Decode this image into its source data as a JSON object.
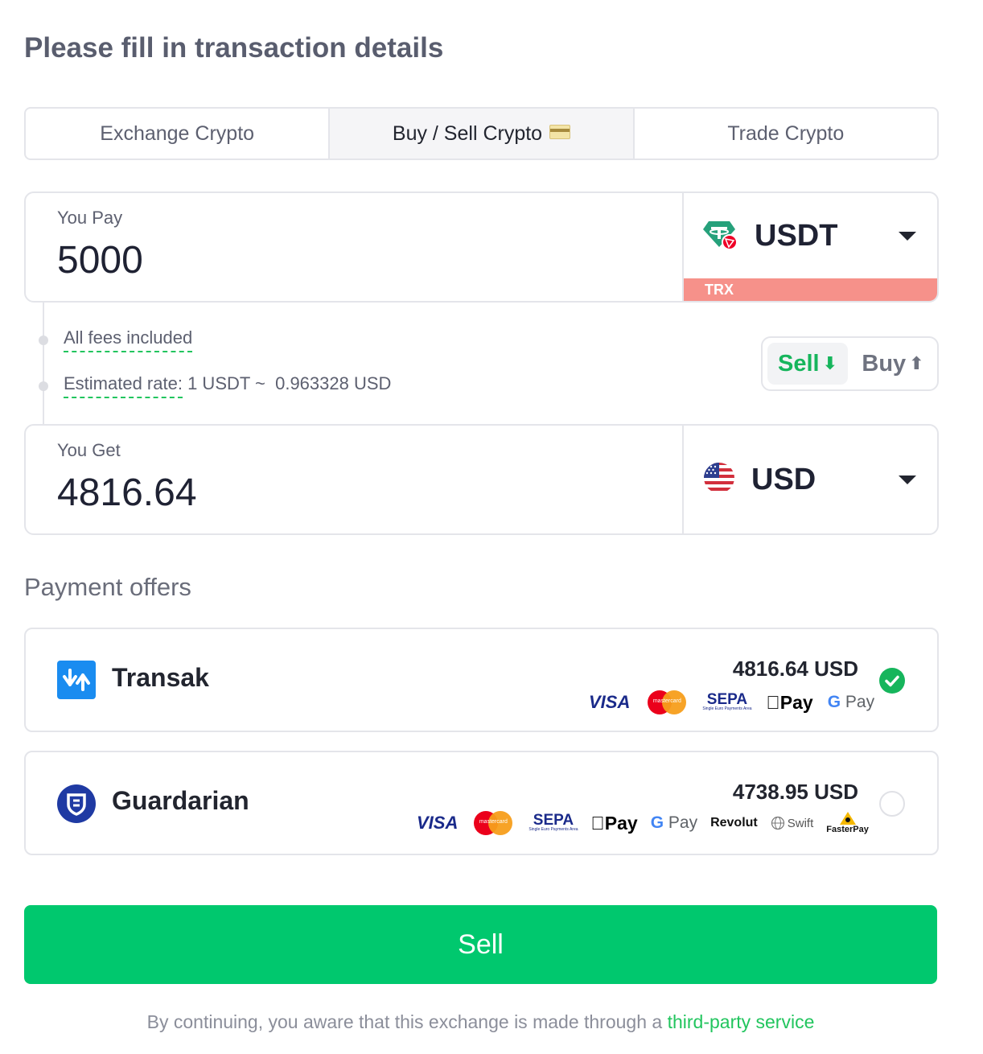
{
  "title": "Please fill in transaction details",
  "tabs": [
    {
      "label": "Exchange Crypto",
      "active": false
    },
    {
      "label": "Buy / Sell Crypto",
      "active": true,
      "icon": "credit-card-icon"
    },
    {
      "label": "Trade Crypto",
      "active": false
    }
  ],
  "pay": {
    "label": "You Pay",
    "amount": "5000",
    "currency": "USDT",
    "currency_icon": "tether-trx-icon",
    "network": "TRX",
    "network_color": "#f6918a"
  },
  "info": {
    "fees": "All fees included",
    "rate_label": "Estimated rate:",
    "rate_value": "1 USDT ~  0.963328 USD"
  },
  "toggle": {
    "sell": "Sell",
    "sell_arrow": "⬇",
    "buy": "Buy",
    "buy_arrow": "⬆",
    "selected": "sell"
  },
  "get": {
    "label": "You Get",
    "amount": "4816.64",
    "currency": "USD",
    "currency_icon": "us-flag-icon"
  },
  "offers_title": "Payment offers",
  "offers": [
    {
      "name": "Transak",
      "price": "4816.64 USD",
      "selected": true,
      "methods": [
        "VISA",
        "mastercard",
        "SEPA",
        "Pay",
        "Pay"
      ]
    },
    {
      "name": "Guardarian",
      "price": "4738.95 USD",
      "selected": false,
      "methods": [
        "VISA",
        "mastercard",
        "SEPA",
        "Pay",
        "Pay",
        "Revolut",
        "Swift",
        "FasterPay"
      ]
    }
  ],
  "sepa_sub": "Single Euro Payments Area",
  "submit_label": "Sell",
  "footer": {
    "text": "By continuing, you aware that this exchange is made through a ",
    "link": "third-party service"
  },
  "colors": {
    "accent_green": "#00c86e",
    "text_green": "#16b55c",
    "border": "#e4e5ea"
  }
}
